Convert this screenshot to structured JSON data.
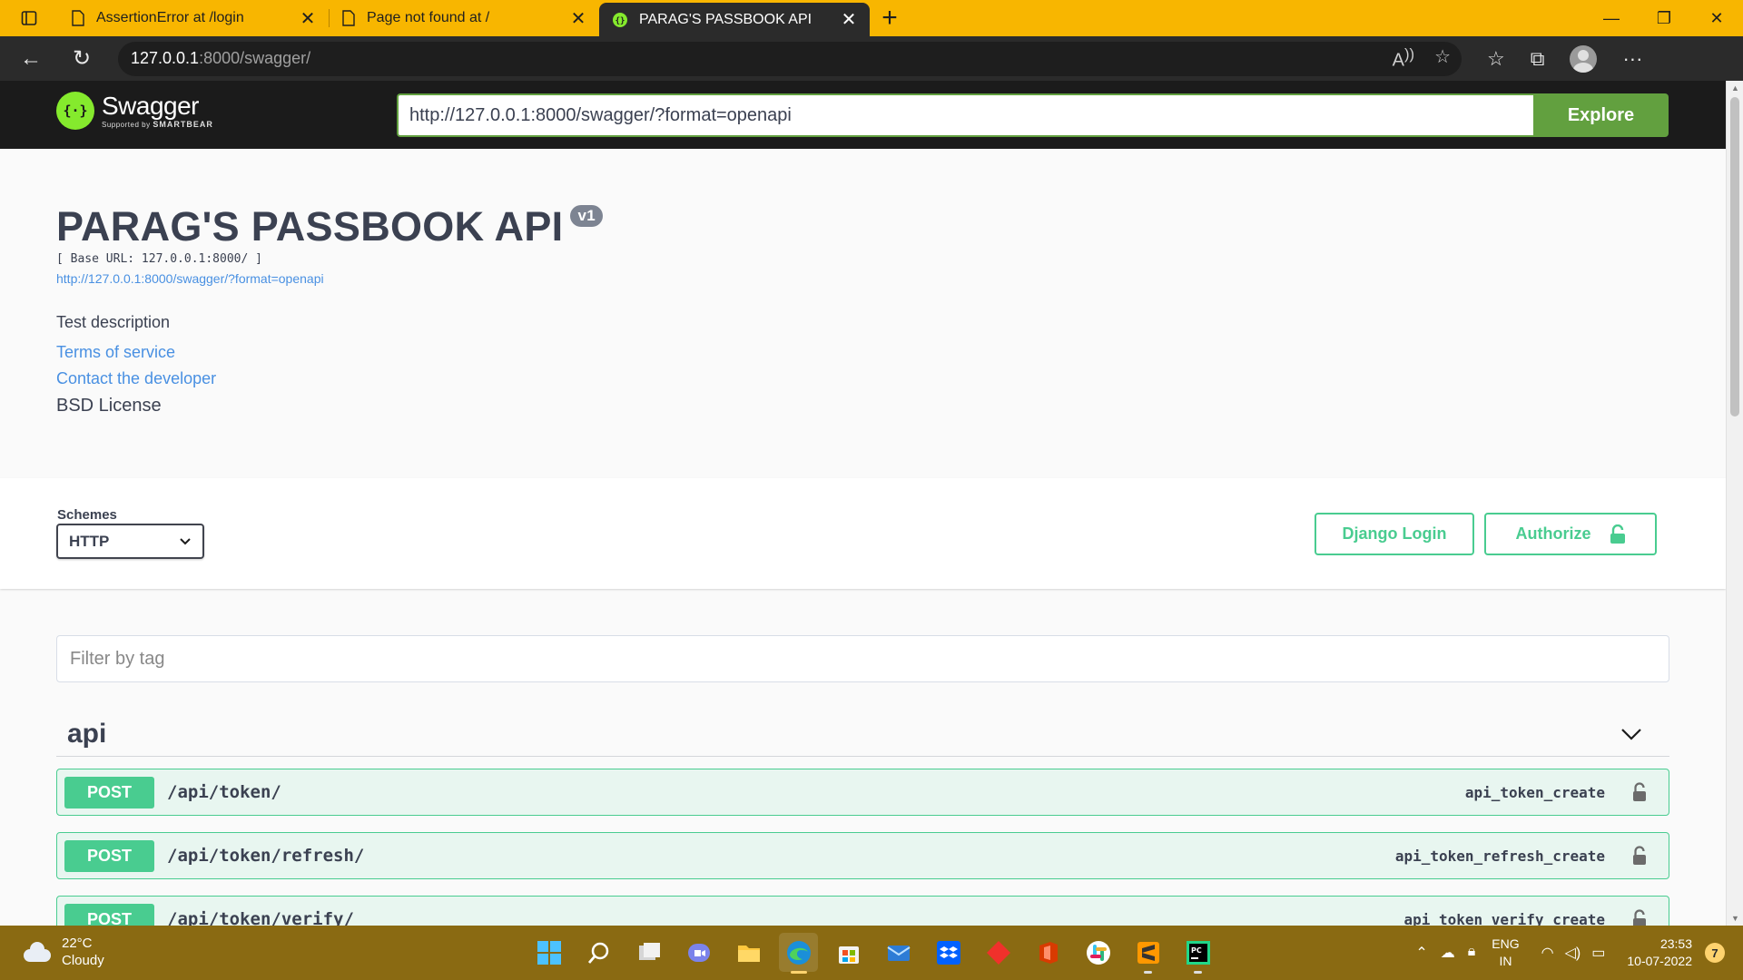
{
  "browser": {
    "tabs": [
      {
        "title": "AssertionError at /login",
        "active": false
      },
      {
        "title": "Page not found at /",
        "active": false
      },
      {
        "title": "PARAG'S PASSBOOK API",
        "active": true
      }
    ],
    "address": {
      "host": "127.0.0.1",
      "path": ":8000/swagger/"
    }
  },
  "swagger": {
    "logo": {
      "name": "Swagger",
      "supported": "Supported by",
      "brand": "SMARTBEAR"
    },
    "spec_url_value": "http://127.0.0.1:8000/swagger/?format=openapi",
    "explore_label": "Explore"
  },
  "info": {
    "title": "PARAG'S PASSBOOK API",
    "version": "v1",
    "base_url": "[ Base URL: 127.0.0.1:8000/ ]",
    "spec_link": "http://127.0.0.1:8000/swagger/?format=openapi",
    "description": "Test description",
    "terms": "Terms of service",
    "contact": "Contact the developer",
    "license": "BSD License"
  },
  "schemes": {
    "label": "Schemes",
    "selected": "HTTP",
    "django_login": "Django Login",
    "authorize": "Authorize"
  },
  "filter": {
    "placeholder": "Filter by tag"
  },
  "tag": {
    "name": "api"
  },
  "operations": [
    {
      "method": "POST",
      "path": "/api/token/",
      "operation_id": "api_token_create"
    },
    {
      "method": "POST",
      "path": "/api/token/refresh/",
      "operation_id": "api_token_refresh_create"
    },
    {
      "method": "POST",
      "path": "/api/token/verify/",
      "operation_id": "api_token_verify_create"
    }
  ],
  "taskbar": {
    "weather_temp": "22°C",
    "weather_desc": "Cloudy",
    "lang_1": "ENG",
    "lang_2": "IN",
    "time": "23:53",
    "date": "10-07-2022",
    "notifications": "7"
  },
  "colors": {
    "post": "#49cc90",
    "swagger_green": "#62a03f",
    "browser_accent": "#f8b600"
  }
}
